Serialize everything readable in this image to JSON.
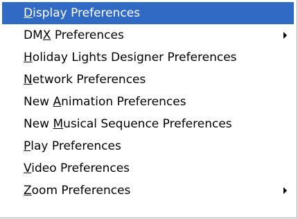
{
  "menu": {
    "items": [
      {
        "pre": "",
        "key": "D",
        "post": "isplay Preferences",
        "selected": true,
        "submenu": false
      },
      {
        "pre": "DM",
        "key": "X",
        "post": " Preferences",
        "selected": false,
        "submenu": true
      },
      {
        "pre": "",
        "key": "H",
        "post": "oliday Lights Designer Preferences",
        "selected": false,
        "submenu": false
      },
      {
        "pre": "",
        "key": "N",
        "post": "etwork Preferences",
        "selected": false,
        "submenu": false
      },
      {
        "pre": "New ",
        "key": "A",
        "post": "nimation Preferences",
        "selected": false,
        "submenu": false
      },
      {
        "pre": "New ",
        "key": "M",
        "post": "usical Sequence Preferences",
        "selected": false,
        "submenu": false
      },
      {
        "pre": "",
        "key": "P",
        "post": "lay Preferences",
        "selected": false,
        "submenu": false
      },
      {
        "pre": "",
        "key": "V",
        "post": "ideo Preferences",
        "selected": false,
        "submenu": false
      },
      {
        "pre": "",
        "key": "Z",
        "post": "oom Preferences",
        "selected": false,
        "submenu": true
      }
    ],
    "colors": {
      "highlight": "#316ac5",
      "highlight_text": "#ffffff",
      "text": "#000000"
    }
  }
}
